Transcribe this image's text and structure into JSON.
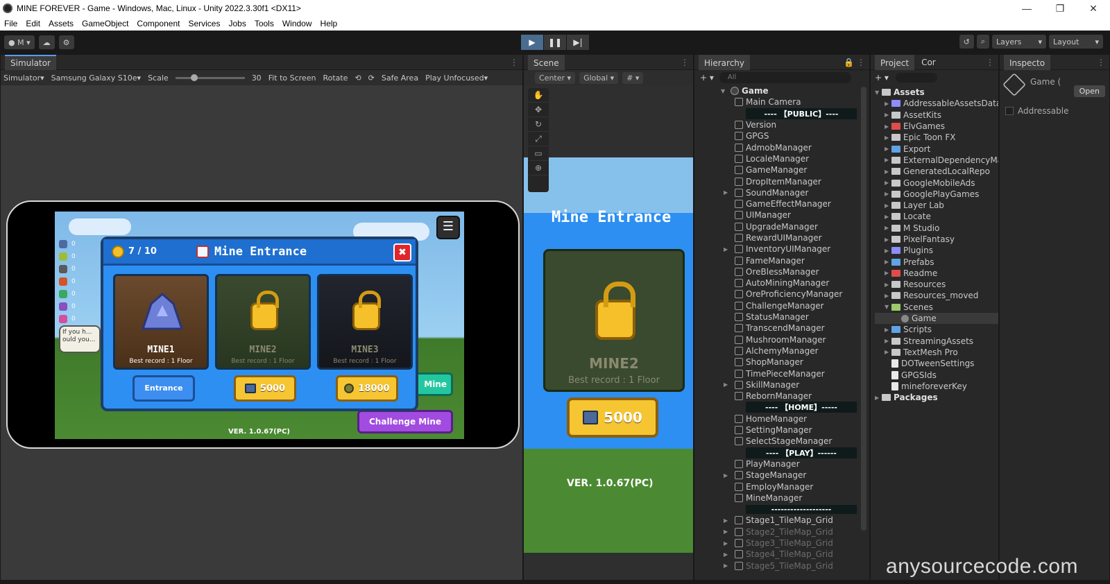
{
  "window": {
    "title": "MINE  FOREVER - Game - Windows, Mac, Linux - Unity 2022.3.30f1 <DX11>",
    "controls": [
      "—",
      "❐",
      "✕"
    ]
  },
  "menu": [
    "File",
    "Edit",
    "Assets",
    "GameObject",
    "Component",
    "Services",
    "Jobs",
    "Tools",
    "Window",
    "Help"
  ],
  "toolbar": {
    "account": "M",
    "layers_label": "Layers",
    "layout_label": "Layout"
  },
  "simulator": {
    "tab": "Simulator",
    "mode": "Simulator",
    "device": "Samsung Galaxy S10e",
    "scale_label": "Scale",
    "scale_value": "30",
    "fit": "Fit to Screen",
    "rotate": "Rotate",
    "safe_area": "Safe Area",
    "play_mode": "Play Unfocused"
  },
  "game": {
    "popup_title": "Mine Entrance",
    "counter": "7 / 10",
    "mines": [
      {
        "name": "MINE1",
        "record": "Best record : 1 Floor",
        "button": "Entrance"
      },
      {
        "name": "MINE2",
        "record": "Best record : 1 Floor",
        "button": "5000"
      },
      {
        "name": "MINE3",
        "record": "Best record : 1 Floor",
        "button": "18000"
      }
    ],
    "challenge_button": "Challenge Mine",
    "side_button": "Mine",
    "version": "VER. 1.0.67(PC)",
    "tip_text": "If you h... ould you..."
  },
  "scene": {
    "tab": "Scene",
    "pivot": "Center",
    "space": "Global",
    "title": "Mine Entrance",
    "mine_name": "MINE2",
    "record": "Best record : 1 Floor",
    "price": "5000",
    "version": "VER. 1.0.67(PC)"
  },
  "hierarchy": {
    "tab": "Hierarchy",
    "search_placeholder": "All",
    "root": "Game",
    "rows": [
      {
        "label": "Main Camera",
        "type": "obj"
      },
      {
        "label": "---- 【PUBLIC】----",
        "type": "sep"
      },
      {
        "label": "Version",
        "type": "obj"
      },
      {
        "label": "GPGS",
        "type": "obj"
      },
      {
        "label": "AdmobManager",
        "type": "obj"
      },
      {
        "label": "LocaleManager",
        "type": "obj"
      },
      {
        "label": "GameManager",
        "type": "obj"
      },
      {
        "label": "DropItemManager",
        "type": "obj"
      },
      {
        "label": "SoundManager",
        "type": "obj",
        "arrow": true
      },
      {
        "label": "GameEffectManager",
        "type": "obj"
      },
      {
        "label": "UIManager",
        "type": "obj"
      },
      {
        "label": "UpgradeManager",
        "type": "obj"
      },
      {
        "label": "RewardUIManager",
        "type": "obj"
      },
      {
        "label": "InventoryUIManager",
        "type": "obj",
        "arrow": true
      },
      {
        "label": "FameManager",
        "type": "obj"
      },
      {
        "label": "OreBlessManager",
        "type": "obj"
      },
      {
        "label": "AutoMiningManager",
        "type": "obj"
      },
      {
        "label": "OreProficiencyManager",
        "type": "obj"
      },
      {
        "label": "ChallengeManager",
        "type": "obj"
      },
      {
        "label": "StatusManager",
        "type": "obj"
      },
      {
        "label": "TranscendManager",
        "type": "obj"
      },
      {
        "label": "MushroomManager",
        "type": "obj"
      },
      {
        "label": "AlchemyManager",
        "type": "obj"
      },
      {
        "label": "ShopManager",
        "type": "obj"
      },
      {
        "label": "TimePieceManager",
        "type": "obj"
      },
      {
        "label": "SkillManager",
        "type": "obj",
        "arrow": true
      },
      {
        "label": "RebornManager",
        "type": "obj"
      },
      {
        "label": "---- 【HOME】-----",
        "type": "sep"
      },
      {
        "label": "HomeManager",
        "type": "obj"
      },
      {
        "label": "SettingManager",
        "type": "obj"
      },
      {
        "label": "SelectStageManager",
        "type": "obj"
      },
      {
        "label": "---- 【PLAY】------",
        "type": "sep"
      },
      {
        "label": "PlayManager",
        "type": "obj"
      },
      {
        "label": "StageManager",
        "type": "obj",
        "arrow": true
      },
      {
        "label": "EmployManager",
        "type": "obj"
      },
      {
        "label": "MineManager",
        "type": "obj"
      },
      {
        "label": "-------------------",
        "type": "sep"
      },
      {
        "label": "Stage1_TileMap_Grid",
        "type": "obj",
        "arrow": true
      },
      {
        "label": "Stage2_TileMap_Grid",
        "type": "dim",
        "arrow": true
      },
      {
        "label": "Stage3_TileMap_Grid",
        "type": "dim",
        "arrow": true
      },
      {
        "label": "Stage4_TileMap_Grid",
        "type": "dim",
        "arrow": true
      },
      {
        "label": "Stage5_TileMap_Grid",
        "type": "dim",
        "arrow": true
      }
    ]
  },
  "project": {
    "tab": "Project",
    "tab2": "Cor",
    "rows": [
      {
        "label": "Assets",
        "level": 0,
        "bold": true,
        "expanded": true
      },
      {
        "label": "AddressableAssetsData",
        "level": 1,
        "color": "#8e8cff"
      },
      {
        "label": "AssetKits",
        "level": 1
      },
      {
        "label": "ElvGames",
        "level": 1,
        "color": "#e34b4b"
      },
      {
        "label": "Epic Toon FX",
        "level": 1
      },
      {
        "label": "Export",
        "level": 1,
        "color": "#5fa3e6"
      },
      {
        "label": "ExternalDependencyManager",
        "level": 1
      },
      {
        "label": "GeneratedLocalRepo",
        "level": 1
      },
      {
        "label": "GoogleMobileAds",
        "level": 1
      },
      {
        "label": "GooglePlayGames",
        "level": 1
      },
      {
        "label": "Layer Lab",
        "level": 1
      },
      {
        "label": "Locate",
        "level": 1
      },
      {
        "label": "M Studio",
        "level": 1
      },
      {
        "label": "PixelFantasy",
        "level": 1
      },
      {
        "label": "Plugins",
        "level": 1,
        "color": "#8e8cff"
      },
      {
        "label": "Prefabs",
        "level": 1,
        "color": "#5fa3e6"
      },
      {
        "label": "Readme",
        "level": 1,
        "color": "#e34b4b"
      },
      {
        "label": "Resources",
        "level": 1
      },
      {
        "label": "Resources_moved",
        "level": 1
      },
      {
        "label": "Scenes",
        "level": 1,
        "expanded": true,
        "color": "#9cc96b"
      },
      {
        "label": "Game",
        "level": 2,
        "selected": true,
        "scene": true
      },
      {
        "label": "Scripts",
        "level": 1,
        "color": "#5fa3e6"
      },
      {
        "label": "StreamingAssets",
        "level": 1
      },
      {
        "label": "TextMesh Pro",
        "level": 1
      },
      {
        "label": "DOTweenSettings",
        "level": 1,
        "file": true
      },
      {
        "label": "GPGSIds",
        "level": 1,
        "file": true
      },
      {
        "label": "mineforeverKey",
        "level": 1,
        "file": true
      },
      {
        "label": "Packages",
        "level": 0,
        "bold": true
      }
    ]
  },
  "inspector": {
    "tab": "Inspecto",
    "name": "Game (",
    "open": "Open",
    "addressable": "Addressable"
  },
  "watermark": "anysourcecode.com"
}
